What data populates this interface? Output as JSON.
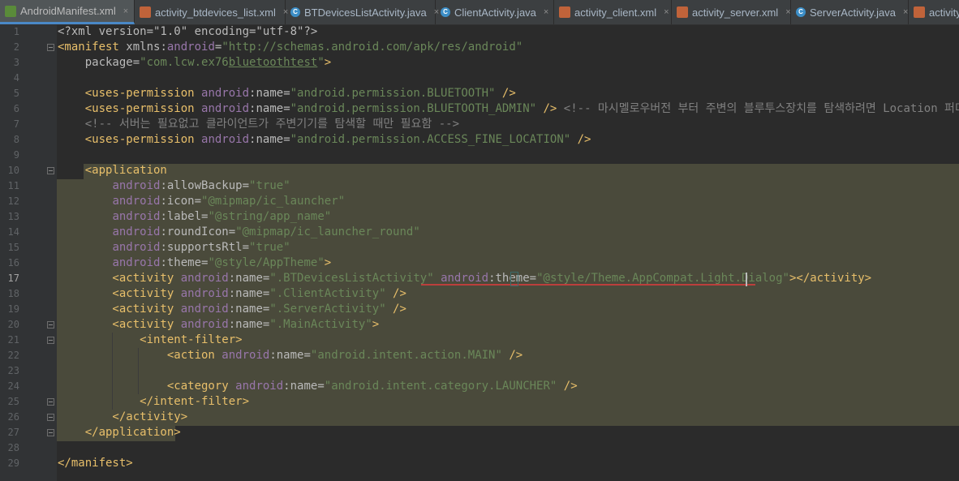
{
  "tabs": [
    {
      "label": "AndroidManifest.xml",
      "type": "MF",
      "active": true,
      "closable": true
    },
    {
      "label": "activity_btdevices_list.xml",
      "type": "XML",
      "closable": true
    },
    {
      "label": "BTDevicesListActivity.java",
      "type": "JAVA",
      "closable": true
    },
    {
      "label": "ClientActivity.java",
      "type": "JAVA",
      "closable": true
    },
    {
      "label": "activity_client.xml",
      "type": "XML",
      "closable": true
    },
    {
      "label": "activity_server.xml",
      "type": "XML",
      "closable": true
    },
    {
      "label": "ServerActivity.java",
      "type": "JAVA",
      "closable": true
    },
    {
      "label": "activity",
      "type": "XML",
      "closable": false
    }
  ],
  "close_glyph": "×",
  "current_line": 17,
  "line_numbers": [
    "1",
    "2",
    "3",
    "4",
    "5",
    "6",
    "7",
    "8",
    "9",
    "10",
    "11",
    "12",
    "13",
    "14",
    "15",
    "16",
    "17",
    "18",
    "19",
    "20",
    "21",
    "22",
    "23",
    "24",
    "25",
    "26",
    "27",
    "28",
    "29"
  ],
  "code_lines": [
    [
      {
        "t": "<?xml version=\"1.0\" encoding=\"utf-8\"?>",
        "c": "attr"
      }
    ],
    [
      {
        "t": "<manifest ",
        "c": "tag"
      },
      {
        "t": "xmlns:",
        "c": "attr"
      },
      {
        "t": "android",
        "c": "ns"
      },
      {
        "t": "=",
        "c": "attr"
      },
      {
        "t": "\"http://schemas.android.com/apk/res/android\"",
        "c": "val"
      }
    ],
    [
      {
        "t": "    package",
        "c": "attr"
      },
      {
        "t": "=",
        "c": "attr"
      },
      {
        "t": "\"com.lcw.ex76",
        "c": "val"
      },
      {
        "t": "bluetoothtest",
        "c": "val ul"
      },
      {
        "t": "\"",
        "c": "val"
      },
      {
        "t": ">",
        "c": "tag"
      }
    ],
    [],
    [
      {
        "t": "    <uses-permission ",
        "c": "tag"
      },
      {
        "t": "android",
        "c": "ns"
      },
      {
        "t": ":name",
        "c": "attr"
      },
      {
        "t": "=",
        "c": "attr"
      },
      {
        "t": "\"android.permission.BLUETOOTH\"",
        "c": "val"
      },
      {
        "t": " />",
        "c": "tag"
      }
    ],
    [
      {
        "t": "    <uses-permission ",
        "c": "tag"
      },
      {
        "t": "android",
        "c": "ns"
      },
      {
        "t": ":name",
        "c": "attr"
      },
      {
        "t": "=",
        "c": "attr"
      },
      {
        "t": "\"android.permission.BLUETOOTH_ADMIN\"",
        "c": "val"
      },
      {
        "t": " />",
        "c": "tag"
      },
      {
        "t": " <!-- 마시멜로우버전 부터 주변의 블루투스장치를 탐색하려면 Location 퍼미션",
        "c": "cmt"
      }
    ],
    [
      {
        "t": "    <!-- 서버는 필요없고 클라이언트가 주변기기를 탐색할 때만 필요함 -->",
        "c": "cmt"
      }
    ],
    [
      {
        "t": "    <uses-permission ",
        "c": "tag"
      },
      {
        "t": "android",
        "c": "ns"
      },
      {
        "t": ":name",
        "c": "attr"
      },
      {
        "t": "=",
        "c": "attr"
      },
      {
        "t": "\"android.permission.ACCESS_FINE_LOCATION\"",
        "c": "val"
      },
      {
        "t": " />",
        "c": "tag"
      }
    ],
    [],
    [
      {
        "t": "    <application",
        "c": "tag"
      }
    ],
    [
      {
        "t": "        ",
        "c": "attr"
      },
      {
        "t": "android",
        "c": "ns"
      },
      {
        "t": ":allowBackup",
        "c": "attr"
      },
      {
        "t": "=",
        "c": "attr"
      },
      {
        "t": "\"true\"",
        "c": "val"
      }
    ],
    [
      {
        "t": "        ",
        "c": "attr"
      },
      {
        "t": "android",
        "c": "ns"
      },
      {
        "t": ":icon",
        "c": "attr"
      },
      {
        "t": "=",
        "c": "attr"
      },
      {
        "t": "\"@mipmap/ic_launcher\"",
        "c": "val"
      }
    ],
    [
      {
        "t": "        ",
        "c": "attr"
      },
      {
        "t": "android",
        "c": "ns"
      },
      {
        "t": ":label",
        "c": "attr"
      },
      {
        "t": "=",
        "c": "attr"
      },
      {
        "t": "\"@string/app_name\"",
        "c": "val"
      }
    ],
    [
      {
        "t": "        ",
        "c": "attr"
      },
      {
        "t": "android",
        "c": "ns"
      },
      {
        "t": ":roundIcon",
        "c": "attr"
      },
      {
        "t": "=",
        "c": "attr"
      },
      {
        "t": "\"@mipmap/ic_launcher_round\"",
        "c": "val"
      }
    ],
    [
      {
        "t": "        ",
        "c": "attr"
      },
      {
        "t": "android",
        "c": "ns"
      },
      {
        "t": ":supportsRtl",
        "c": "attr"
      },
      {
        "t": "=",
        "c": "attr"
      },
      {
        "t": "\"true\"",
        "c": "val"
      }
    ],
    [
      {
        "t": "        ",
        "c": "attr"
      },
      {
        "t": "android",
        "c": "ns"
      },
      {
        "t": ":theme",
        "c": "attr"
      },
      {
        "t": "=",
        "c": "attr"
      },
      {
        "t": "\"@style/AppTheme\"",
        "c": "val"
      },
      {
        "t": ">",
        "c": "tag"
      }
    ],
    [
      {
        "t": "        <activity ",
        "c": "tag"
      },
      {
        "t": "android",
        "c": "ns"
      },
      {
        "t": ":name",
        "c": "attr"
      },
      {
        "t": "=",
        "c": "attr"
      },
      {
        "t": "\".BTDevicesListActivity\"",
        "c": "val"
      },
      {
        "t": " ",
        "c": "attr"
      },
      {
        "t": "android",
        "c": "ns"
      },
      {
        "t": ":theme",
        "c": "attr"
      },
      {
        "t": "=",
        "c": "attr"
      },
      {
        "t": "\"@style/Theme.AppCompat.Light.Dialog\"",
        "c": "val"
      },
      {
        "t": "></activity>",
        "c": "tag"
      }
    ],
    [
      {
        "t": "        <activity ",
        "c": "tag"
      },
      {
        "t": "android",
        "c": "ns"
      },
      {
        "t": ":name",
        "c": "attr"
      },
      {
        "t": "=",
        "c": "attr"
      },
      {
        "t": "\".ClientActivity\"",
        "c": "val"
      },
      {
        "t": " />",
        "c": "tag"
      }
    ],
    [
      {
        "t": "        <activity ",
        "c": "tag"
      },
      {
        "t": "android",
        "c": "ns"
      },
      {
        "t": ":name",
        "c": "attr"
      },
      {
        "t": "=",
        "c": "attr"
      },
      {
        "t": "\".ServerActivity\"",
        "c": "val"
      },
      {
        "t": " />",
        "c": "tag"
      }
    ],
    [
      {
        "t": "        <activity ",
        "c": "tag"
      },
      {
        "t": "android",
        "c": "ns"
      },
      {
        "t": ":name",
        "c": "attr"
      },
      {
        "t": "=",
        "c": "attr"
      },
      {
        "t": "\".MainActivity\"",
        "c": "val"
      },
      {
        "t": ">",
        "c": "tag"
      }
    ],
    [
      {
        "t": "            <intent-filter>",
        "c": "tag"
      }
    ],
    [
      {
        "t": "                <action ",
        "c": "tag"
      },
      {
        "t": "android",
        "c": "ns"
      },
      {
        "t": ":name",
        "c": "attr"
      },
      {
        "t": "=",
        "c": "attr"
      },
      {
        "t": "\"android.intent.action.MAIN\"",
        "c": "val"
      },
      {
        "t": " />",
        "c": "tag"
      }
    ],
    [],
    [
      {
        "t": "                <category ",
        "c": "tag"
      },
      {
        "t": "android",
        "c": "ns"
      },
      {
        "t": ":name",
        "c": "attr"
      },
      {
        "t": "=",
        "c": "attr"
      },
      {
        "t": "\"android.intent.category.LAUNCHER\"",
        "c": "val"
      },
      {
        "t": " />",
        "c": "tag"
      }
    ],
    [
      {
        "t": "            </intent-filter>",
        "c": "tag"
      }
    ],
    [
      {
        "t": "        </activity>",
        "c": "tag"
      }
    ],
    [
      {
        "t": "    </application>",
        "c": "tag"
      }
    ],
    [],
    [
      {
        "t": "</manifest>",
        "c": "tag"
      }
    ]
  ],
  "colors": {
    "editor_bg": "#2b2b2b",
    "gutter_bg": "#313335",
    "tag": "#e8bf6a",
    "namespace": "#9876aa",
    "attribute": "#bababa",
    "string": "#6a8759",
    "comment": "#808080",
    "selection": "#4a4a3b",
    "error_underline": "#bc3f3c",
    "active_tab_underline": "#4a88c7"
  },
  "icons": {
    "manifest_file": "manifest-file-icon",
    "xml_file": "xml-file-icon",
    "java_class": "java-class-icon",
    "intention_bulb": "lightbulb-icon"
  }
}
